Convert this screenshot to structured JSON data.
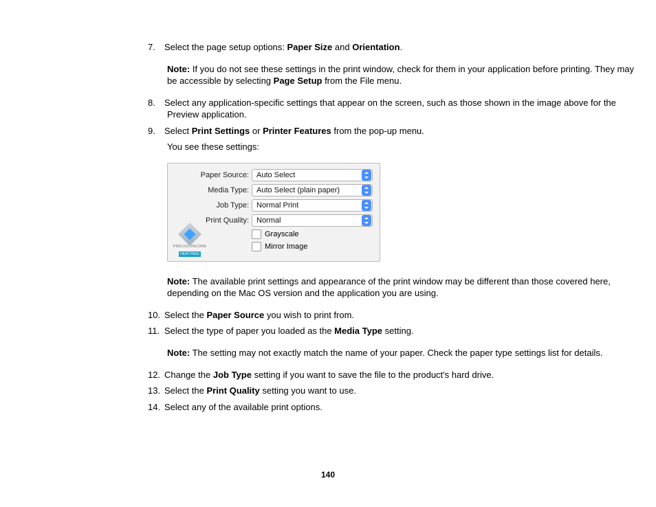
{
  "steps": {
    "s7_a": "Select the page setup options: ",
    "s7_b1": "Paper Size",
    "s7_mid": " and ",
    "s7_b2": "Orientation",
    "s7_end": ".",
    "note1_label": "Note:",
    "note1_a": " If you do not see these settings in the print window, check for them in your application before printing. They may be accessible by selecting ",
    "note1_b": "Page Setup",
    "note1_c": " from the File menu.",
    "s8": "Select any application-specific settings that appear on the screen, such as those shown in the image above for the Preview application.",
    "s9_a": "Select ",
    "s9_b1": "Print Settings",
    "s9_mid": " or ",
    "s9_b2": "Printer Features",
    "s9_c": " from the pop-up menu.",
    "s9_sub": "You see these settings:",
    "note2_label": "Note:",
    "note2_text": " The available print settings and appearance of the print window may be different than those covered here, depending on the Mac OS version and the application you are using.",
    "s10_a": "Select the ",
    "s10_b": "Paper Source",
    "s10_c": " you wish to print from.",
    "s11_a": "Select the type of paper you loaded as the ",
    "s11_b": "Media Type",
    "s11_c": " setting.",
    "note3_label": "Note:",
    "note3_text": " The setting may not exactly match the name of your paper. Check the paper type settings list for details.",
    "s12_a": "Change the ",
    "s12_b": "Job Type",
    "s12_c": " setting if you want to save the file to the product's hard drive.",
    "s13_a": "Select the ",
    "s13_b": "Print Quality",
    "s13_c": " setting you want to use.",
    "s14": "Select any of the available print options."
  },
  "figure": {
    "labels": {
      "paper_source": "Paper Source:",
      "media_type": "Media Type:",
      "job_type": "Job Type:",
      "print_quality": "Print Quality:"
    },
    "values": {
      "paper_source": "Auto Select",
      "media_type": "Auto Select (plain paper)",
      "job_type": "Normal Print",
      "print_quality": "Normal"
    },
    "checkboxes": {
      "grayscale": "Grayscale",
      "mirror": "Mirror Image"
    },
    "logo": {
      "line1": "PRECISIONCORE",
      "line2": "HEAT-FREE"
    }
  },
  "page_number": "140"
}
